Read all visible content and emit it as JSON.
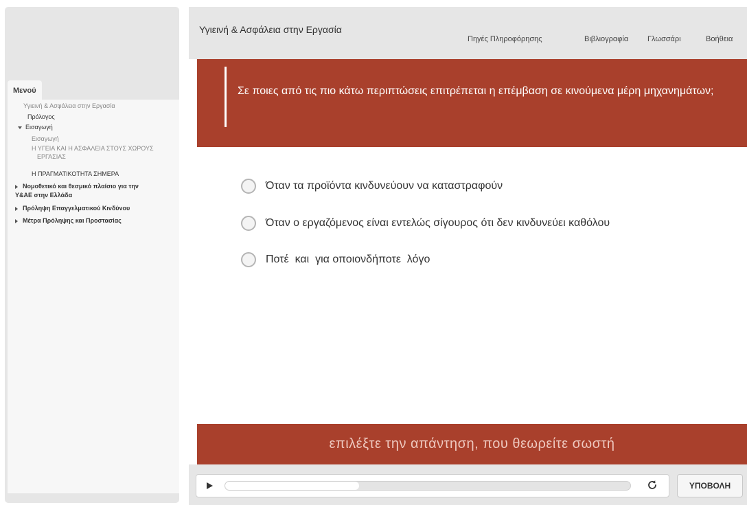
{
  "sidebar": {
    "menu_label": "Μενού",
    "items": [
      {
        "label": "Υγιεινή & Ασφάλεια στην Εργασία"
      },
      {
        "label": "Πρόλογος"
      },
      {
        "label": "Εισαγωγή",
        "icon": "triangle-down-icon"
      },
      {
        "label": "Εισαγωγή"
      },
      {
        "label": "Η ΥΓΕΙΑ ΚΑΙ Η ΑΣΦΑΛΕΙΑ ΣΤΟΥΣ ΧΩΡΟΥΣ"
      },
      {
        "label": "ΕΡΓΑΣΙΑΣ"
      },
      {
        "label": "Η ΠΡΑΓΜΑΤΙΚΟΤΗΤΑ ΣΗΜΕΡΑ"
      },
      {
        "label": "Νομοθετικό και θεσμικό πλαίσιο για την",
        "icon": "triangle-right-icon"
      },
      {
        "label": "Υ&ΑΕ στην Ελλάδα"
      },
      {
        "label": "Πρόληψη Επαγγελματικού Κινδύνου",
        "icon": "triangle-right-icon"
      },
      {
        "label": "Μέτρα Πρόληψης και Προστασίας",
        "icon": "triangle-right-icon"
      }
    ]
  },
  "header": {
    "title": "Υγιεινή & Ασφάλεια στην Εργασία",
    "links": [
      "Πηγές Πληροφόρησης",
      "Βιβλιογραφία",
      "Γλωσσάρι",
      "Βοήθεια"
    ]
  },
  "question": {
    "text": "Σε ποιες από τις πιο κάτω περιπτώσεις επιτρέπεται η επέμβαση σε κινούμενα μέρη μηχανημάτων;"
  },
  "answers": [
    {
      "label": "Όταν τα προϊόντα κινδυνεύουν να καταστραφούν",
      "selected": false
    },
    {
      "label": "Όταν ο εργαζόμενος είναι εντελώς σίγουρος ότι δεν κινδυνεύει καθόλου",
      "selected": false
    },
    {
      "label": "Ποτέ  και  για οποιονδήποτε  λόγο",
      "selected": false
    }
  ],
  "instruction": "επιλέξτε την απάντηση, που θεωρείτε σωστή",
  "controls": {
    "play_icon": "play-icon",
    "reload_icon": "reload-icon",
    "progress_percent": 33,
    "submit_label": "ΥΠΟΒΟΛΗ"
  },
  "colors": {
    "accent": "#a9402c",
    "panel": "#e6e6e6"
  }
}
